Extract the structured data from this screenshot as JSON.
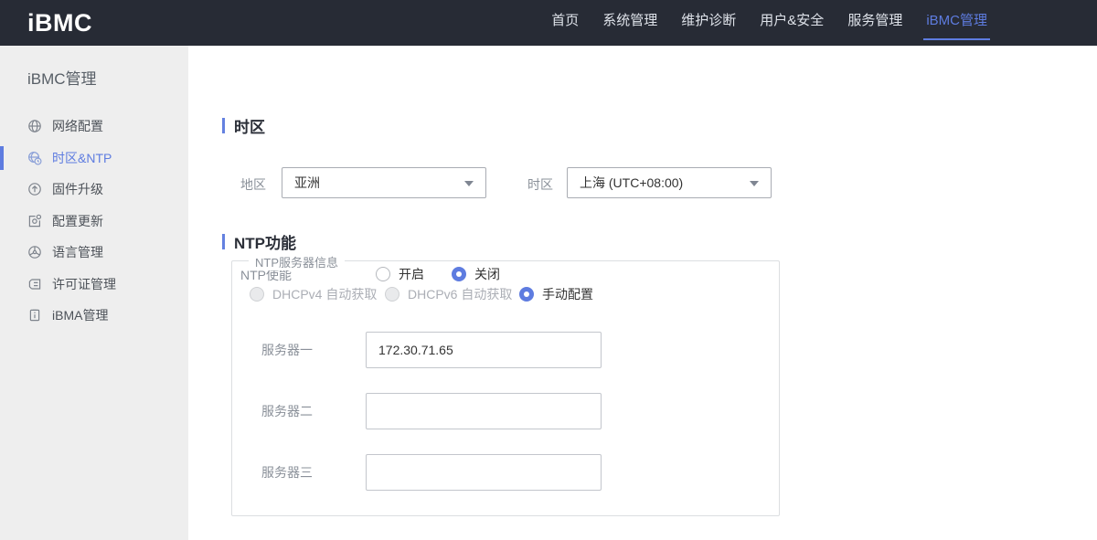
{
  "colors": {
    "accent": "#5e7ce0",
    "header_bg": "#272b35",
    "sidebar_bg": "#eeeeee"
  },
  "header": {
    "logo": "iBMC",
    "nav": [
      {
        "label": "首页",
        "active": false
      },
      {
        "label": "系统管理",
        "active": false
      },
      {
        "label": "维护诊断",
        "active": false
      },
      {
        "label": "用户&安全",
        "active": false
      },
      {
        "label": "服务管理",
        "active": false
      },
      {
        "label": "iBMC管理",
        "active": true
      }
    ]
  },
  "sidebar": {
    "title": "iBMC管理",
    "items": [
      {
        "label": "网络配置",
        "icon": "network-globe-icon",
        "active": false
      },
      {
        "label": "时区&NTP",
        "icon": "timezone-clock-icon",
        "active": true
      },
      {
        "label": "固件升级",
        "icon": "firmware-upgrade-icon",
        "active": false
      },
      {
        "label": "配置更新",
        "icon": "config-update-icon",
        "active": false
      },
      {
        "label": "语言管理",
        "icon": "language-icon",
        "active": false
      },
      {
        "label": "许可证管理",
        "icon": "license-icon",
        "active": false
      },
      {
        "label": "iBMA管理",
        "icon": "ibma-icon",
        "active": false
      }
    ],
    "collapse_icon": "chevron-left-icon"
  },
  "main": {
    "timezone_section": {
      "title": "时区",
      "region_label": "地区",
      "region_value": "亚洲",
      "timezone_label": "时区",
      "timezone_value": "上海 (UTC+08:00)"
    },
    "ntp_section": {
      "title": "NTP功能",
      "enable_label": "NTP使能",
      "enable_options": [
        {
          "label": "开启",
          "checked": false
        },
        {
          "label": "关闭",
          "checked": true
        }
      ],
      "server_group": {
        "legend": "NTP服务器信息",
        "mode_options": [
          {
            "label": "DHCPv4 自动获取",
            "checked": false,
            "disabled": true
          },
          {
            "label": "DHCPv6 自动获取",
            "checked": false,
            "disabled": true
          },
          {
            "label": "手动配置",
            "checked": true,
            "disabled": false
          }
        ],
        "servers": [
          {
            "label": "服务器一",
            "value": "172.30.71.65"
          },
          {
            "label": "服务器二",
            "value": ""
          },
          {
            "label": "服务器三",
            "value": ""
          }
        ]
      }
    }
  }
}
